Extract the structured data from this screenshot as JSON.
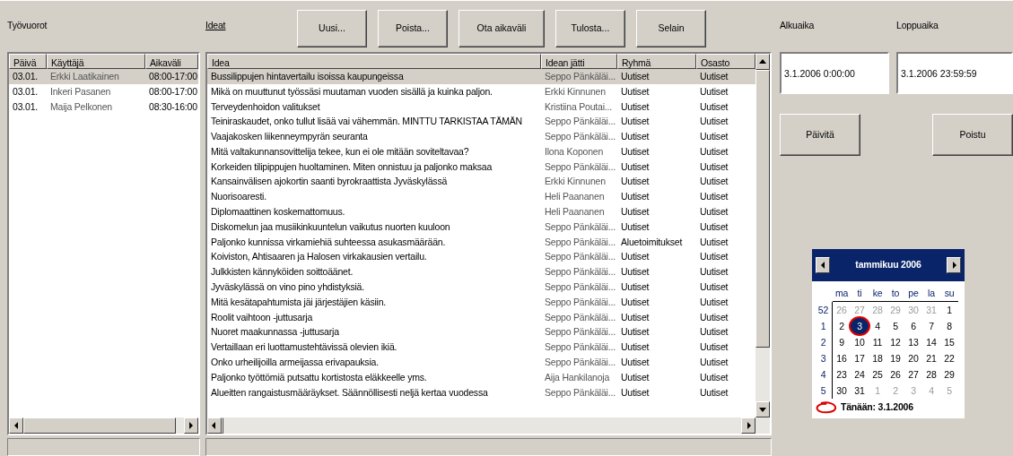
{
  "shifts": {
    "label": "Työvuorot",
    "columns": [
      "Päivä",
      "Käyttäjä",
      "Aikaväli"
    ],
    "rows": [
      {
        "cells": [
          "03.01.",
          "Erkki Laatikainen",
          "08:00-17:00"
        ],
        "selected": true
      },
      {
        "cells": [
          "03.01.",
          "Inkeri Pasanen",
          "08:00-17:00"
        ],
        "selected": false
      },
      {
        "cells": [
          "03.01.",
          "Maija Pelkonen",
          "08:30-16:00"
        ],
        "selected": false
      }
    ]
  },
  "ideas": {
    "label": "Ideat",
    "buttons": [
      "Uusi...",
      "Poista...",
      "Ota aikaväli",
      "Tulosta...",
      "Selain"
    ],
    "columns": [
      "Idea",
      "Idean jätti",
      "Ryhmä",
      "Osasto"
    ],
    "rows": [
      {
        "cells": [
          "Bussilippujen hintavertailu isoissa kaupungeissa",
          "Seppo Pänkäläi...",
          "Uutiset",
          "Uutiset"
        ],
        "selected": true
      },
      {
        "cells": [
          "Mikä on muuttunut työssäsi muutaman vuoden sisällä ja kuinka paljon.",
          "Erkki Kinnunen",
          "Uutiset",
          "Uutiset"
        ],
        "selected": false
      },
      {
        "cells": [
          "Terveydenhoidon valitukset",
          "Kristiina Poutai...",
          "Uutiset",
          "Uutiset"
        ],
        "selected": false
      },
      {
        "cells": [
          "Teiniraskaudet, onko tullut lisää vai vähemmän. MINTTU TARKISTAA TÄMÄN",
          "Seppo Pänkäläi...",
          "Uutiset",
          "Uutiset"
        ],
        "selected": false
      },
      {
        "cells": [
          "Vaajakosken liikenneympyrän seuranta",
          "Seppo Pänkäläi...",
          "Uutiset",
          "Uutiset"
        ],
        "selected": false
      },
      {
        "cells": [
          "Mitä valtakunnansovittelija tekee, kun ei ole mitään soviteltavaa?",
          "Ilona Koponen",
          "Uutiset",
          "Uutiset"
        ],
        "selected": false
      },
      {
        "cells": [
          "Korkeiden tilipippujen huoltaminen. Miten onnistuu ja paljonko maksaa",
          "Seppo Pänkäläi...",
          "Uutiset",
          "Uutiset"
        ],
        "selected": false
      },
      {
        "cells": [
          "Kansainvälisen ajokortin saanti byrokraattista Jyväskylässä",
          "Erkki Kinnunen",
          "Uutiset",
          "Uutiset"
        ],
        "selected": false
      },
      {
        "cells": [
          "Nuorisoaresti.",
          "Heli Paananen",
          "Uutiset",
          "Uutiset"
        ],
        "selected": false
      },
      {
        "cells": [
          "Diplomaattinen koskemattomuus.",
          "Heli Paananen",
          "Uutiset",
          "Uutiset"
        ],
        "selected": false
      },
      {
        "cells": [
          "Diskomelun jaa musiikinkuuntelun vaikutus nuorten kuuloon",
          "Seppo Pänkäläi...",
          "Uutiset",
          "Uutiset"
        ],
        "selected": false
      },
      {
        "cells": [
          "Paljonko kunnissa virkamiehiä suhteessa asukasmäärään.",
          "Seppo Pänkäläi...",
          "Aluetoimitukset",
          "Uutiset"
        ],
        "selected": false
      },
      {
        "cells": [
          "Koiviston, Ahtisaaren ja Halosen virkakausien vertailu.",
          "Seppo Pänkäläi...",
          "Uutiset",
          "Uutiset"
        ],
        "selected": false
      },
      {
        "cells": [
          "Julkkisten kännyköiden soittoäänet.",
          "Seppo Pänkäläi...",
          "Uutiset",
          "Uutiset"
        ],
        "selected": false
      },
      {
        "cells": [
          "Jyväskylässä on vino pino yhdistyksiä.",
          "Seppo Pänkäläi...",
          "Uutiset",
          "Uutiset"
        ],
        "selected": false
      },
      {
        "cells": [
          "Mitä kesätapahtumista jäi järjestäjien käsiin.",
          "Seppo Pänkäläi...",
          "Uutiset",
          "Uutiset"
        ],
        "selected": false
      },
      {
        "cells": [
          "Roolit vaihtoon -juttusarja",
          "Seppo Pänkäläi...",
          "Uutiset",
          "Uutiset"
        ],
        "selected": false
      },
      {
        "cells": [
          "Nuoret maakunnassa -juttusarja",
          "Seppo Pänkäläi...",
          "Uutiset",
          "Uutiset"
        ],
        "selected": false
      },
      {
        "cells": [
          "Vertaillaan eri luottamustehtävissä olevien ikiä.",
          "Seppo Pänkäläi...",
          "Uutiset",
          "Uutiset"
        ],
        "selected": false
      },
      {
        "cells": [
          "Onko urheilijoilla armeijassa erivapauksia.",
          "Seppo Pänkäläi...",
          "Uutiset",
          "Uutiset"
        ],
        "selected": false
      },
      {
        "cells": [
          "Paljonko työttömiä putsattu kortistosta eläkkeelle yms.",
          "Aija Hankilanoja",
          "Uutiset",
          "Uutiset"
        ],
        "selected": false
      },
      {
        "cells": [
          "Alueitten rangaistusmääräykset. Säännöllisesti neljä kertaa vuodessa",
          "Seppo Pänkäläi...",
          "Uutiset",
          "Uutiset"
        ],
        "selected": false
      }
    ]
  },
  "range": {
    "start_label": "Alkuaika",
    "end_label": "Loppuaika",
    "start": "3.1.2006 0:00:00",
    "end": "3.1.2006 23:59:59",
    "buttons": [
      "Päivitä",
      "Poistu"
    ]
  },
  "calendar": {
    "month": "tammikuu 2006",
    "weekdays": [
      "ma",
      "ti",
      "ke",
      "to",
      "pe",
      "la",
      "su"
    ],
    "weeks": [
      {
        "week": "52",
        "days": [
          {
            "day": "26",
            "other_month": true,
            "selected": false
          },
          {
            "day": "27",
            "other_month": true,
            "selected": false
          },
          {
            "day": "28",
            "other_month": true,
            "selected": false
          },
          {
            "day": "29",
            "other_month": true,
            "selected": false
          },
          {
            "day": "30",
            "other_month": true,
            "selected": false
          },
          {
            "day": "31",
            "other_month": true,
            "selected": false
          },
          {
            "day": "1",
            "other_month": false,
            "selected": false
          }
        ]
      },
      {
        "week": "1",
        "days": [
          {
            "day": "2",
            "other_month": false,
            "selected": false
          },
          {
            "day": "3",
            "other_month": false,
            "selected": true
          },
          {
            "day": "4",
            "other_month": false,
            "selected": false
          },
          {
            "day": "5",
            "other_month": false,
            "selected": false
          },
          {
            "day": "6",
            "other_month": false,
            "selected": false
          },
          {
            "day": "7",
            "other_month": false,
            "selected": false
          },
          {
            "day": "8",
            "other_month": false,
            "selected": false
          }
        ]
      },
      {
        "week": "2",
        "days": [
          {
            "day": "9",
            "other_month": false,
            "selected": false
          },
          {
            "day": "10",
            "other_month": false,
            "selected": false
          },
          {
            "day": "11",
            "other_month": false,
            "selected": false
          },
          {
            "day": "12",
            "other_month": false,
            "selected": false
          },
          {
            "day": "13",
            "other_month": false,
            "selected": false
          },
          {
            "day": "14",
            "other_month": false,
            "selected": false
          },
          {
            "day": "15",
            "other_month": false,
            "selected": false
          }
        ]
      },
      {
        "week": "3",
        "days": [
          {
            "day": "16",
            "other_month": false,
            "selected": false
          },
          {
            "day": "17",
            "other_month": false,
            "selected": false
          },
          {
            "day": "18",
            "other_month": false,
            "selected": false
          },
          {
            "day": "19",
            "other_month": false,
            "selected": false
          },
          {
            "day": "20",
            "other_month": false,
            "selected": false
          },
          {
            "day": "21",
            "other_month": false,
            "selected": false
          },
          {
            "day": "22",
            "other_month": false,
            "selected": false
          }
        ]
      },
      {
        "week": "4",
        "days": [
          {
            "day": "23",
            "other_month": false,
            "selected": false
          },
          {
            "day": "24",
            "other_month": false,
            "selected": false
          },
          {
            "day": "25",
            "other_month": false,
            "selected": false
          },
          {
            "day": "26",
            "other_month": false,
            "selected": false
          },
          {
            "day": "27",
            "other_month": false,
            "selected": false
          },
          {
            "day": "28",
            "other_month": false,
            "selected": false
          },
          {
            "day": "29",
            "other_month": false,
            "selected": false
          }
        ]
      },
      {
        "week": "5",
        "days": [
          {
            "day": "30",
            "other_month": false,
            "selected": false
          },
          {
            "day": "31",
            "other_month": false,
            "selected": false
          },
          {
            "day": "1",
            "other_month": true,
            "selected": false
          },
          {
            "day": "2",
            "other_month": true,
            "selected": false
          },
          {
            "day": "3",
            "other_month": true,
            "selected": false
          },
          {
            "day": "4",
            "other_month": true,
            "selected": false
          },
          {
            "day": "5",
            "other_month": true,
            "selected": false
          }
        ]
      }
    ],
    "today": "Tänään: 3.1.2006"
  }
}
